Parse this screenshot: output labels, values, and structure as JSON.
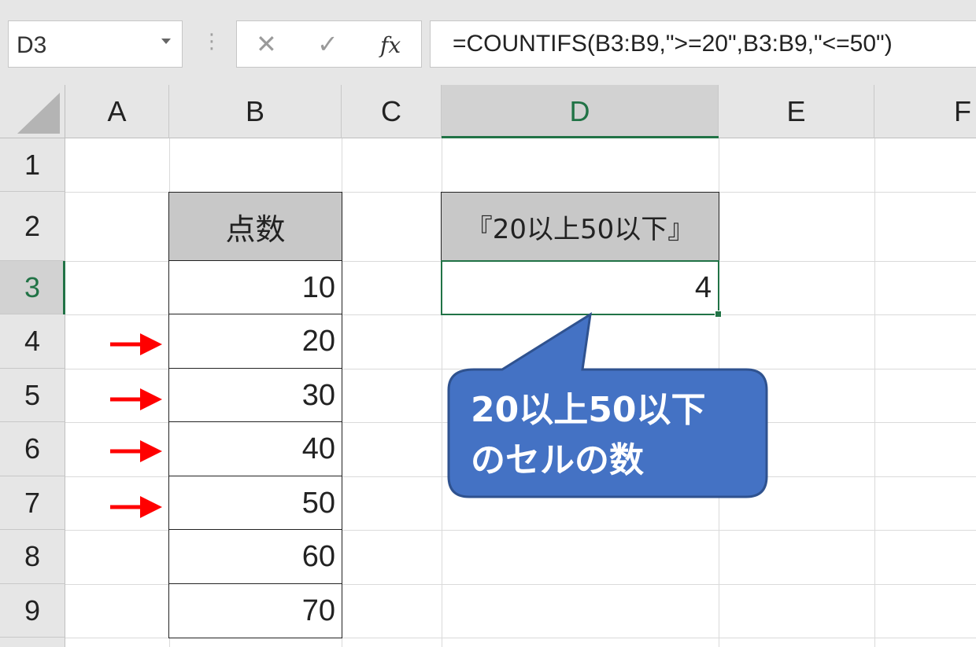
{
  "formula_bar": {
    "name_box": "D3",
    "cancel_symbol": "✕",
    "enter_symbol": "✓",
    "fx_label": "fx",
    "formula": "=COUNTIFS(B3:B9,\">=20\",B3:B9,\"<=50\")"
  },
  "columns": [
    "A",
    "B",
    "C",
    "D",
    "E",
    "F"
  ],
  "rows": [
    "1",
    "2",
    "3",
    "4",
    "5",
    "6",
    "7",
    "8",
    "9"
  ],
  "selected_cell": {
    "column": "D",
    "row": "3"
  },
  "cells": {
    "B2": "点数",
    "B3": "10",
    "B4": "20",
    "B5": "30",
    "B6": "40",
    "B7": "50",
    "B8": "60",
    "B9": "70",
    "D2": "『20以上50以下』",
    "D3": "4"
  },
  "arrows": {
    "rows": [
      "4",
      "5",
      "6",
      "7"
    ],
    "color": "#ff0000",
    "icon": "right-arrow-icon"
  },
  "callout": {
    "line1": "20以上50以下",
    "line2": "のセルの数",
    "fill": "#4472c4",
    "stroke": "#2f528f"
  },
  "colors": {
    "accent": "#217346",
    "header_bg": "#e6e6e6",
    "table_header_bg": "#c8c8c8"
  }
}
